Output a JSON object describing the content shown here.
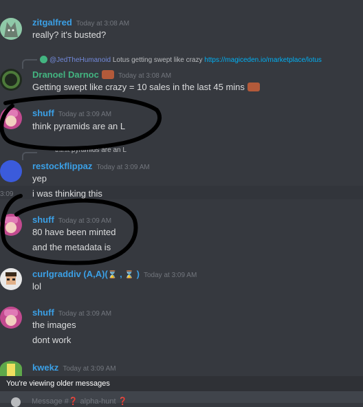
{
  "messages": [
    {
      "user": "zitgalfred",
      "user_color": "#3ba0e6",
      "time": "Today at 3:08 AM",
      "lines": [
        "really? it's busted?"
      ]
    },
    {
      "reply": {
        "mention": "@JedTheHumanoid",
        "text": " Lotus getting swept like crazy ",
        "link": "https://magiceden.io/marketplace/lotus"
      },
      "user": "Dranoel Darnoc",
      "user_color": "#43b581",
      "time": "Today at 3:08 AM",
      "lines": [
        "Getting swept like crazy = 10 sales in the last 45 mins"
      ]
    },
    {
      "user": "shuff",
      "user_color": "#3ba0e6",
      "time": "Today at 3:09 AM",
      "lines": [
        "think pyramids are an L"
      ]
    },
    {
      "reply": {
        "text": "think pyramids are an L"
      },
      "user": "restockflippaz",
      "user_color": "#3ba0e6",
      "time": "Today at 3:09 AM",
      "lines": [
        "yep",
        "i was thinking this"
      ],
      "hover_time": "3:09"
    },
    {
      "user": "shuff",
      "user_color": "#3ba0e6",
      "time": "Today at 3:09 AM",
      "lines": [
        "80 have been minted",
        "and the metadata is"
      ]
    },
    {
      "user": "curlgraddiv (A,A)(",
      "user_suffix": " , ",
      "user_end": " )",
      "user_color": "#3ba0e6",
      "time": "Today at 3:09 AM",
      "lines": [
        "lol"
      ]
    },
    {
      "user": "shuff",
      "user_color": "#3ba0e6",
      "time": "Today at 3:09 AM",
      "lines": [
        "the images",
        "dont work"
      ]
    },
    {
      "user": "kwekz",
      "user_color": "#3ba0e6",
      "time": "Today at 3:09 AM",
      "lines": []
    }
  ],
  "notice": "You're viewing older messages",
  "input": {
    "placeholder": "Message #❓ alpha-hunt ❓"
  },
  "colors": {
    "bg": "#36393f",
    "accent": "#7289da",
    "link": "#00b0f4"
  }
}
